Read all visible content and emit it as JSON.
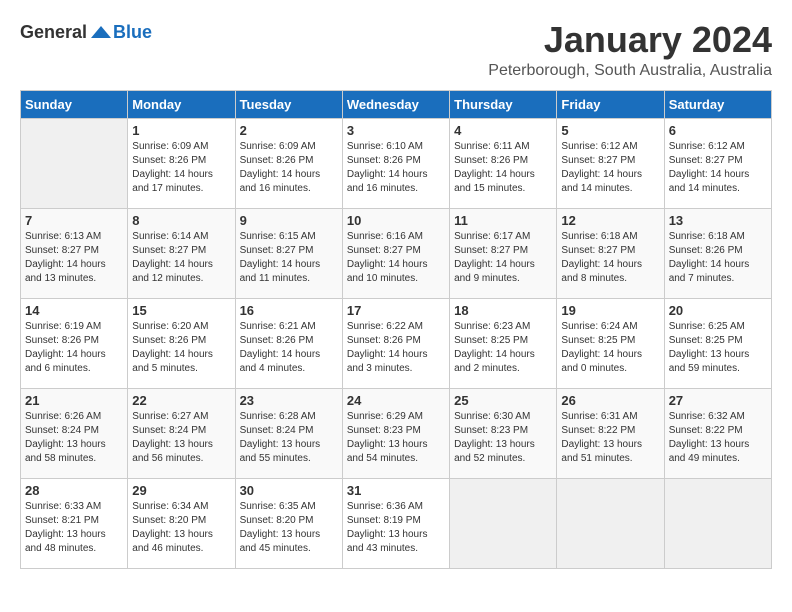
{
  "header": {
    "logo_general": "General",
    "logo_blue": "Blue",
    "month_title": "January 2024",
    "location": "Peterborough, South Australia, Australia"
  },
  "weekdays": [
    "Sunday",
    "Monday",
    "Tuesday",
    "Wednesday",
    "Thursday",
    "Friday",
    "Saturday"
  ],
  "weeks": [
    [
      {
        "day": "",
        "info": ""
      },
      {
        "day": "1",
        "info": "Sunrise: 6:09 AM\nSunset: 8:26 PM\nDaylight: 14 hours\nand 17 minutes."
      },
      {
        "day": "2",
        "info": "Sunrise: 6:09 AM\nSunset: 8:26 PM\nDaylight: 14 hours\nand 16 minutes."
      },
      {
        "day": "3",
        "info": "Sunrise: 6:10 AM\nSunset: 8:26 PM\nDaylight: 14 hours\nand 16 minutes."
      },
      {
        "day": "4",
        "info": "Sunrise: 6:11 AM\nSunset: 8:26 PM\nDaylight: 14 hours\nand 15 minutes."
      },
      {
        "day": "5",
        "info": "Sunrise: 6:12 AM\nSunset: 8:27 PM\nDaylight: 14 hours\nand 14 minutes."
      },
      {
        "day": "6",
        "info": "Sunrise: 6:12 AM\nSunset: 8:27 PM\nDaylight: 14 hours\nand 14 minutes."
      }
    ],
    [
      {
        "day": "7",
        "info": "Sunrise: 6:13 AM\nSunset: 8:27 PM\nDaylight: 14 hours\nand 13 minutes."
      },
      {
        "day": "8",
        "info": "Sunrise: 6:14 AM\nSunset: 8:27 PM\nDaylight: 14 hours\nand 12 minutes."
      },
      {
        "day": "9",
        "info": "Sunrise: 6:15 AM\nSunset: 8:27 PM\nDaylight: 14 hours\nand 11 minutes."
      },
      {
        "day": "10",
        "info": "Sunrise: 6:16 AM\nSunset: 8:27 PM\nDaylight: 14 hours\nand 10 minutes."
      },
      {
        "day": "11",
        "info": "Sunrise: 6:17 AM\nSunset: 8:27 PM\nDaylight: 14 hours\nand 9 minutes."
      },
      {
        "day": "12",
        "info": "Sunrise: 6:18 AM\nSunset: 8:27 PM\nDaylight: 14 hours\nand 8 minutes."
      },
      {
        "day": "13",
        "info": "Sunrise: 6:18 AM\nSunset: 8:26 PM\nDaylight: 14 hours\nand 7 minutes."
      }
    ],
    [
      {
        "day": "14",
        "info": "Sunrise: 6:19 AM\nSunset: 8:26 PM\nDaylight: 14 hours\nand 6 minutes."
      },
      {
        "day": "15",
        "info": "Sunrise: 6:20 AM\nSunset: 8:26 PM\nDaylight: 14 hours\nand 5 minutes."
      },
      {
        "day": "16",
        "info": "Sunrise: 6:21 AM\nSunset: 8:26 PM\nDaylight: 14 hours\nand 4 minutes."
      },
      {
        "day": "17",
        "info": "Sunrise: 6:22 AM\nSunset: 8:26 PM\nDaylight: 14 hours\nand 3 minutes."
      },
      {
        "day": "18",
        "info": "Sunrise: 6:23 AM\nSunset: 8:25 PM\nDaylight: 14 hours\nand 2 minutes."
      },
      {
        "day": "19",
        "info": "Sunrise: 6:24 AM\nSunset: 8:25 PM\nDaylight: 14 hours\nand 0 minutes."
      },
      {
        "day": "20",
        "info": "Sunrise: 6:25 AM\nSunset: 8:25 PM\nDaylight: 13 hours\nand 59 minutes."
      }
    ],
    [
      {
        "day": "21",
        "info": "Sunrise: 6:26 AM\nSunset: 8:24 PM\nDaylight: 13 hours\nand 58 minutes."
      },
      {
        "day": "22",
        "info": "Sunrise: 6:27 AM\nSunset: 8:24 PM\nDaylight: 13 hours\nand 56 minutes."
      },
      {
        "day": "23",
        "info": "Sunrise: 6:28 AM\nSunset: 8:24 PM\nDaylight: 13 hours\nand 55 minutes."
      },
      {
        "day": "24",
        "info": "Sunrise: 6:29 AM\nSunset: 8:23 PM\nDaylight: 13 hours\nand 54 minutes."
      },
      {
        "day": "25",
        "info": "Sunrise: 6:30 AM\nSunset: 8:23 PM\nDaylight: 13 hours\nand 52 minutes."
      },
      {
        "day": "26",
        "info": "Sunrise: 6:31 AM\nSunset: 8:22 PM\nDaylight: 13 hours\nand 51 minutes."
      },
      {
        "day": "27",
        "info": "Sunrise: 6:32 AM\nSunset: 8:22 PM\nDaylight: 13 hours\nand 49 minutes."
      }
    ],
    [
      {
        "day": "28",
        "info": "Sunrise: 6:33 AM\nSunset: 8:21 PM\nDaylight: 13 hours\nand 48 minutes."
      },
      {
        "day": "29",
        "info": "Sunrise: 6:34 AM\nSunset: 8:20 PM\nDaylight: 13 hours\nand 46 minutes."
      },
      {
        "day": "30",
        "info": "Sunrise: 6:35 AM\nSunset: 8:20 PM\nDaylight: 13 hours\nand 45 minutes."
      },
      {
        "day": "31",
        "info": "Sunrise: 6:36 AM\nSunset: 8:19 PM\nDaylight: 13 hours\nand 43 minutes."
      },
      {
        "day": "",
        "info": ""
      },
      {
        "day": "",
        "info": ""
      },
      {
        "day": "",
        "info": ""
      }
    ]
  ]
}
